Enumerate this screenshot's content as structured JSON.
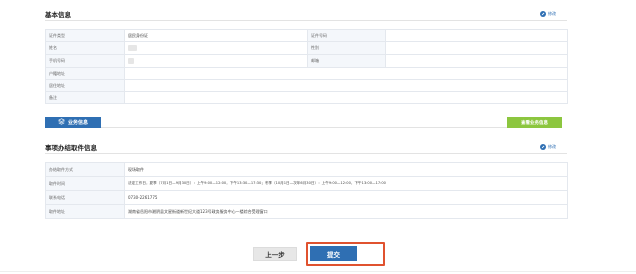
{
  "basic_info": {
    "title": "基本信息",
    "edit_label": "修改",
    "rows": [
      {
        "label1": "证件类型",
        "value1": "居民身份证",
        "label2": "证件号码",
        "value2": ""
      },
      {
        "label1": "姓名",
        "value1": "",
        "label2": "性别",
        "value2": ""
      },
      {
        "label1": "手机号码",
        "value1": "",
        "label2": "邮箱",
        "value2": ""
      },
      {
        "label1": "户籍地址",
        "value1": ""
      },
      {
        "label1": "居住地址",
        "value1": ""
      },
      {
        "label1": "备注",
        "value1": ""
      }
    ]
  },
  "business_bar": {
    "business_info_label": "业务信息",
    "view_business_info_label": "查看业务信息"
  },
  "pickup_info": {
    "title": "事项办结取件信息",
    "edit_label": "修改",
    "rows": [
      {
        "label": "办结取件方式",
        "value": "现场取件"
      },
      {
        "label": "取件时间",
        "value": "法定工作日，夏季（7月1日—9月30日）：上午9:00—12:00，下午13:30—17:30；冬季（10月1日—次年6月30日）：上午9:00—12:00，下午13:00—17:00"
      },
      {
        "label": "联系电话",
        "value": "0730-2261775"
      },
      {
        "label": "取件地址",
        "value": "湖南省岳阳市湘阴县文星街道新世纪大道123号政务服务中心一楼综合受理窗口"
      }
    ]
  },
  "actions": {
    "prev_label": "上一步",
    "submit_label": "提交"
  },
  "colors": {
    "primary": "#2f6fb3",
    "accent_green": "#8cc63f",
    "highlight": "#e0522f"
  }
}
